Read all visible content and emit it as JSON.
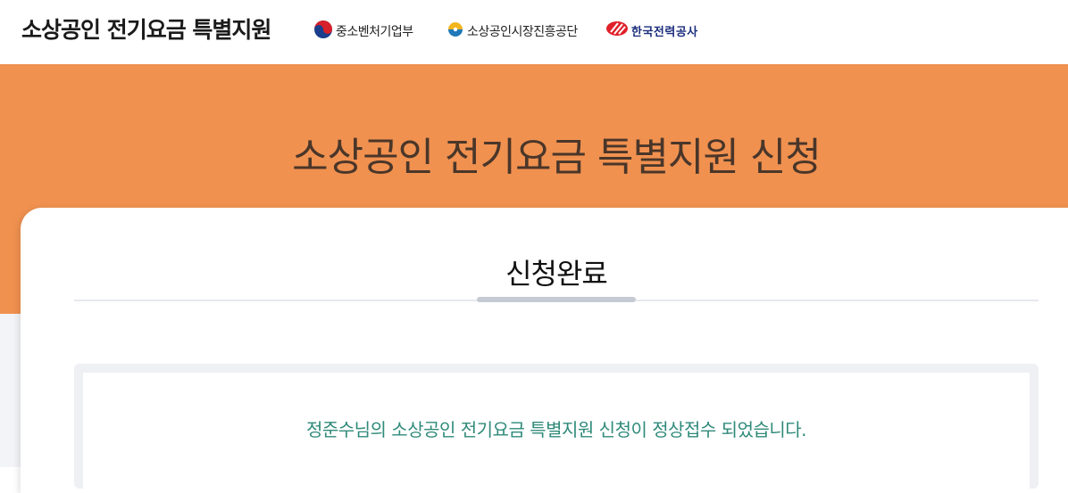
{
  "header": {
    "site_title": "소상공인 전기요금 특별지원",
    "orgs": [
      {
        "label": "중소벤처기업부",
        "icon": "taegeuk-icon"
      },
      {
        "label": "소상공인시장진흥공단",
        "icon": "semas-logo-icon"
      },
      {
        "label": "한국전력공사",
        "icon": "kepco-logo-icon"
      }
    ]
  },
  "banner": {
    "title": "소상공인 전기요금 특별지원 신청"
  },
  "main": {
    "section_title": "신청완료",
    "message": "정준수님의 소상공인 전기요금 특별지원 신청이 정상접수 되었습니다."
  },
  "colors": {
    "banner_bg": "#f09150",
    "banner_text": "#4a3629",
    "message_text": "#2f8a7a",
    "tab_underline": "#c6cad3",
    "kepco_blue": "#1c2f7d",
    "kepco_red": "#e0202a"
  }
}
